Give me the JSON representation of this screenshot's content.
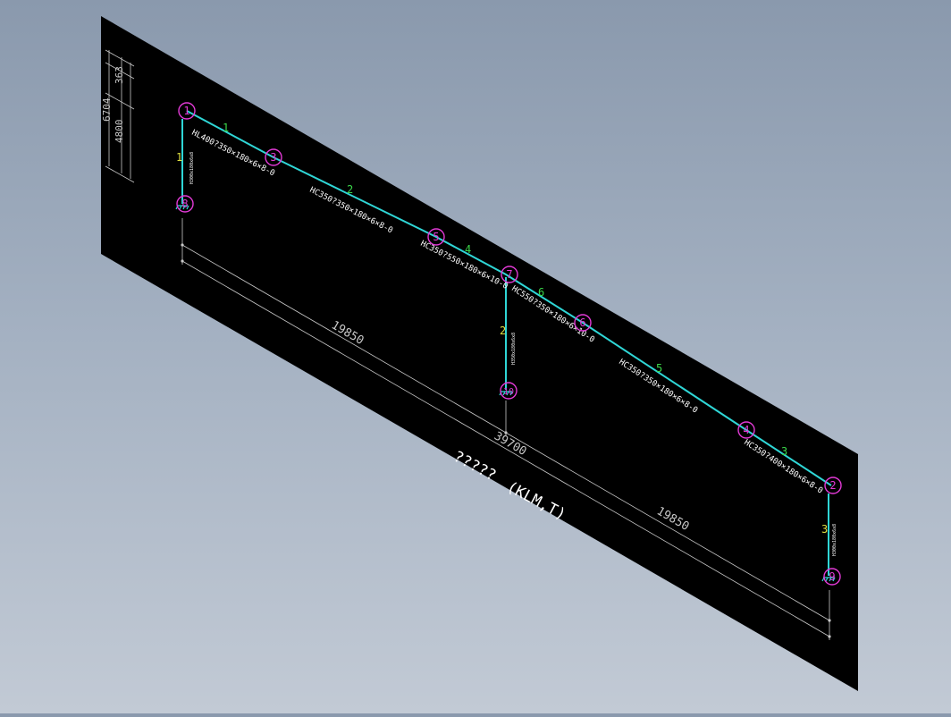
{
  "drawing": {
    "title": "?????",
    "subtitle": "(KLM,T)",
    "colors": {
      "sheet": "#000000",
      "frame": "#2fd6d6",
      "node_circle": "#e23ad6",
      "member_number": "#3ad84a",
      "column_number": "#e0e040",
      "text": "#ffffff",
      "dimension": "#c8c8c8"
    },
    "nodes": [
      {
        "id": "1",
        "label": "1"
      },
      {
        "id": "3",
        "label": "3"
      },
      {
        "id": "8",
        "label": "8"
      },
      {
        "id": "5",
        "label": "5"
      },
      {
        "id": "7",
        "label": "7"
      },
      {
        "id": "10",
        "label": "10"
      },
      {
        "id": "6",
        "label": "6"
      },
      {
        "id": "4",
        "label": "4"
      },
      {
        "id": "2",
        "label": "2"
      },
      {
        "id": "9",
        "label": "9"
      }
    ],
    "member_numbers": [
      "1",
      "2",
      "4",
      "6",
      "5",
      "3"
    ],
    "column_numbers": [
      "1",
      "2",
      "3"
    ],
    "section_labels": [
      "HL400?350×180×6×8-0",
      "HC350?350×180×6×8-0",
      "HC350?550×180×6×10-0",
      "HC550?350×180×6×10-0",
      "HC350?350×180×6×8-0",
      "HC350?400×180×6×8-0"
    ],
    "column_labels": [
      "H300x180x6x8",
      "H350x180x6x8",
      "H300x180x6x8"
    ],
    "dimensions": {
      "left_span": "19850",
      "right_span": "19850",
      "total_span": "39700",
      "heights": [
        "6704",
        "4800",
        "363"
      ]
    }
  }
}
